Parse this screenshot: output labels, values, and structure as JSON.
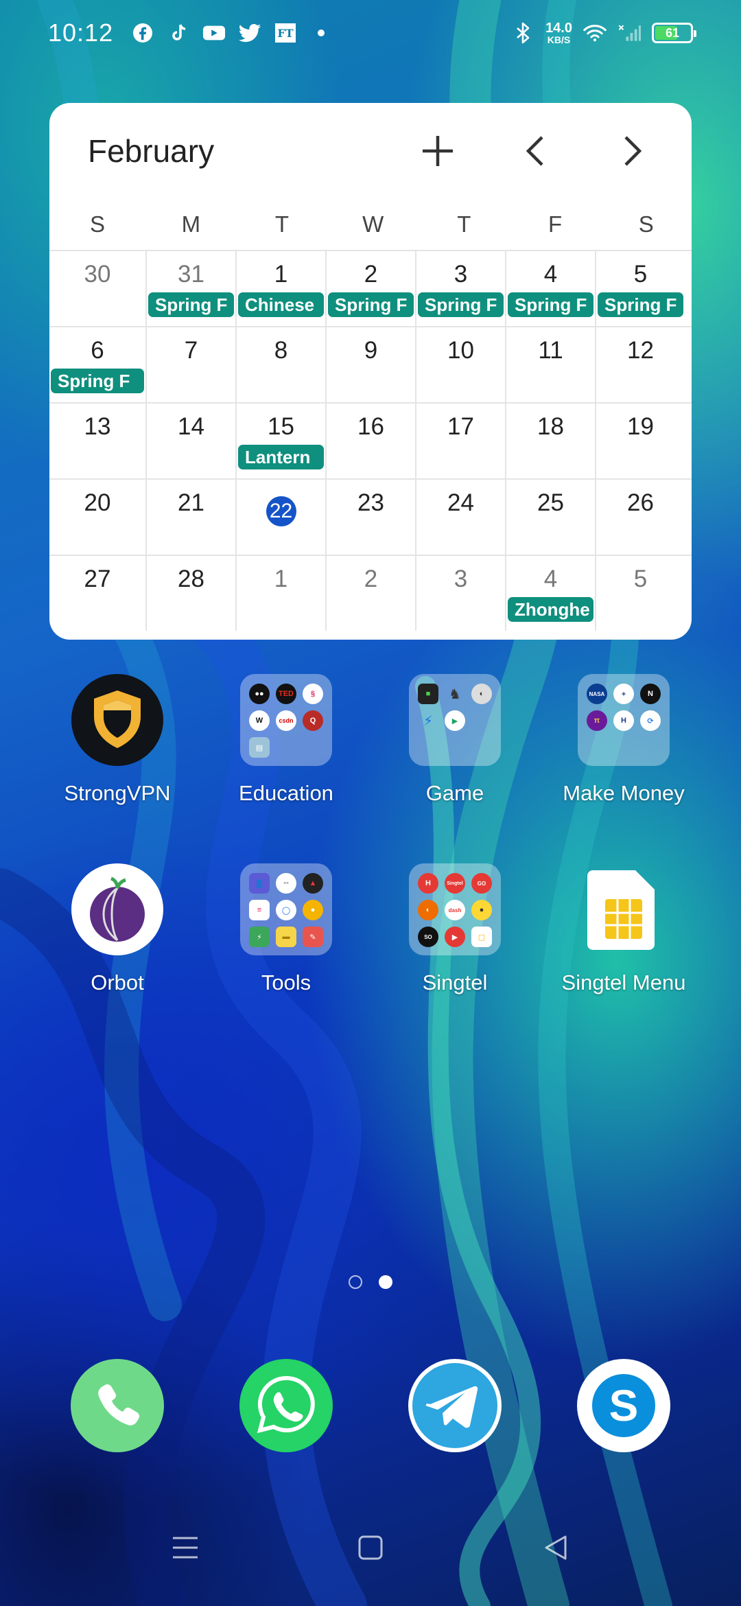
{
  "status_bar": {
    "time": "10:12",
    "net_speed_value": "14.0",
    "net_speed_unit": "KB/S",
    "battery": "61",
    "notification_icons": [
      "facebook-icon",
      "tiktok-icon",
      "youtube-icon",
      "twitter-icon",
      "ft-icon",
      "dot-icon"
    ]
  },
  "calendar": {
    "month": "February",
    "weekdays": [
      "S",
      "M",
      "T",
      "W",
      "T",
      "F",
      "S"
    ],
    "weeks": [
      [
        {
          "day": "30",
          "muted": true,
          "event": ""
        },
        {
          "day": "31",
          "muted": true,
          "event": "Spring F"
        },
        {
          "day": "1",
          "muted": false,
          "event": "Chinese"
        },
        {
          "day": "2",
          "muted": false,
          "event": "Spring F"
        },
        {
          "day": "3",
          "muted": false,
          "event": "Spring F"
        },
        {
          "day": "4",
          "muted": false,
          "event": "Spring F"
        },
        {
          "day": "5",
          "muted": false,
          "event": "Spring F"
        }
      ],
      [
        {
          "day": "6",
          "muted": false,
          "event": "Spring F"
        },
        {
          "day": "7",
          "muted": false,
          "event": ""
        },
        {
          "day": "8",
          "muted": false,
          "event": ""
        },
        {
          "day": "9",
          "muted": false,
          "event": ""
        },
        {
          "day": "10",
          "muted": false,
          "event": ""
        },
        {
          "day": "11",
          "muted": false,
          "event": ""
        },
        {
          "day": "12",
          "muted": false,
          "event": ""
        }
      ],
      [
        {
          "day": "13",
          "muted": false,
          "event": ""
        },
        {
          "day": "14",
          "muted": false,
          "event": ""
        },
        {
          "day": "15",
          "muted": false,
          "event": "Lantern"
        },
        {
          "day": "16",
          "muted": false,
          "event": ""
        },
        {
          "day": "17",
          "muted": false,
          "event": ""
        },
        {
          "day": "18",
          "muted": false,
          "event": ""
        },
        {
          "day": "19",
          "muted": false,
          "event": ""
        }
      ],
      [
        {
          "day": "20",
          "muted": false,
          "event": ""
        },
        {
          "day": "21",
          "muted": false,
          "event": ""
        },
        {
          "day": "22",
          "muted": false,
          "event": "",
          "today": true
        },
        {
          "day": "23",
          "muted": false,
          "event": ""
        },
        {
          "day": "24",
          "muted": false,
          "event": ""
        },
        {
          "day": "25",
          "muted": false,
          "event": ""
        },
        {
          "day": "26",
          "muted": false,
          "event": ""
        }
      ],
      [
        {
          "day": "27",
          "muted": false,
          "event": ""
        },
        {
          "day": "28",
          "muted": false,
          "event": ""
        },
        {
          "day": "1",
          "muted": true,
          "event": ""
        },
        {
          "day": "2",
          "muted": true,
          "event": ""
        },
        {
          "day": "3",
          "muted": true,
          "event": ""
        },
        {
          "day": "4",
          "muted": true,
          "event": "Zhonghe"
        },
        {
          "day": "5",
          "muted": true,
          "event": ""
        }
      ]
    ],
    "event_color": "#0f8f7e",
    "today_color": "#1554c8"
  },
  "apps": {
    "strongvpn": {
      "label": "StrongVPN",
      "icon": "strongvpn-shield-icon"
    },
    "education": {
      "label": "Education",
      "icon": "education-folder-icon"
    },
    "game": {
      "label": "Game",
      "icon": "game-folder-icon"
    },
    "make_money": {
      "label": "Make Money",
      "icon": "make-money-folder-icon"
    },
    "orbot": {
      "label": "Orbot",
      "icon": "orbot-onion-icon"
    },
    "tools": {
      "label": "Tools",
      "icon": "tools-folder-icon"
    },
    "singtel": {
      "label": "Singtel",
      "icon": "singtel-folder-icon"
    },
    "singtel_menu": {
      "label": "Singtel Menu",
      "icon": "sim-card-icon"
    }
  },
  "dock": [
    "phone-icon",
    "whatsapp-icon",
    "telegram-icon",
    "skype-icon"
  ],
  "pager": {
    "pages": 2,
    "current": 2
  },
  "navbar": [
    "menu-icon",
    "home-icon",
    "back-icon"
  ]
}
